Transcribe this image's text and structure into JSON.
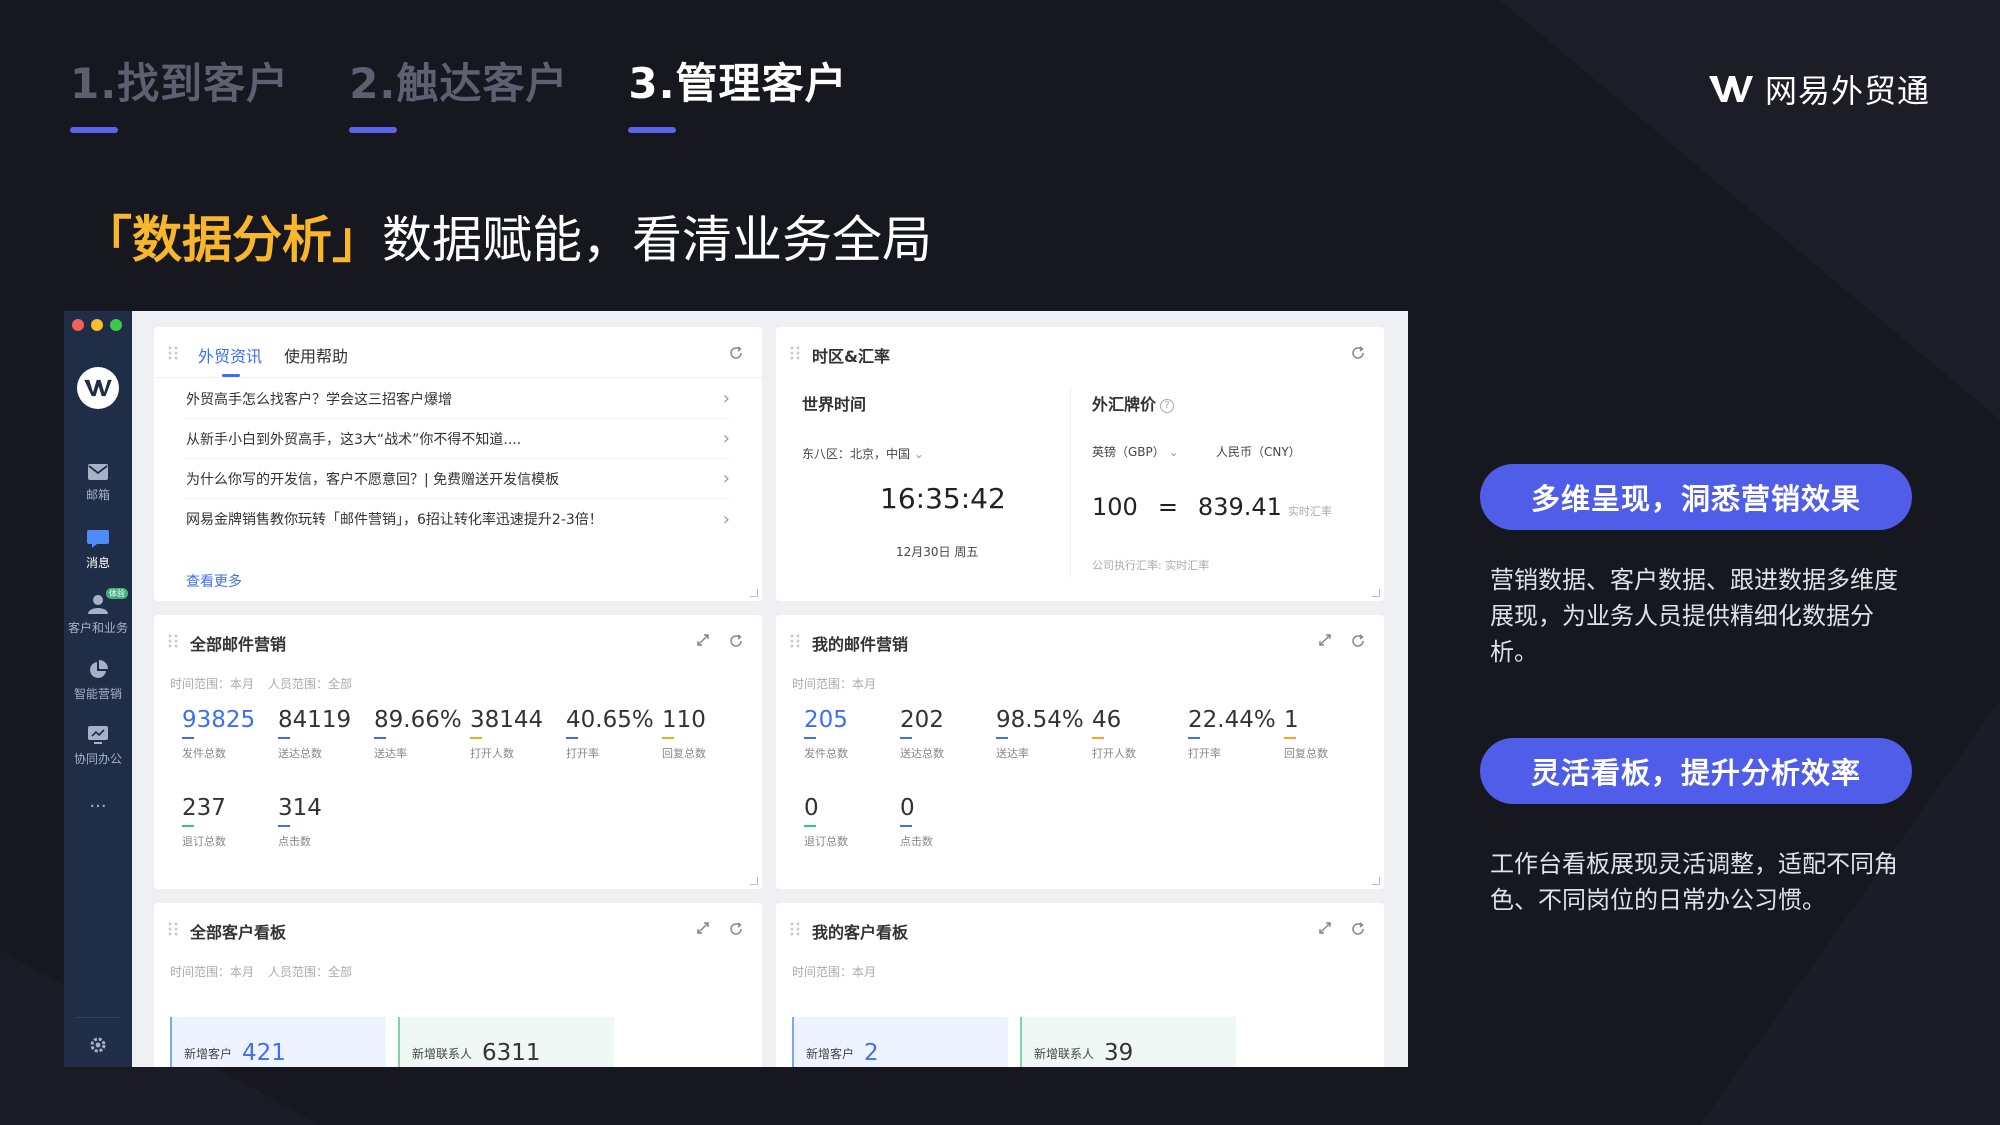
{
  "steps": [
    {
      "label": "1.找到客户",
      "active": false
    },
    {
      "label": "2.触达客户",
      "active": false
    },
    {
      "label": "3.管理客户",
      "active": true
    }
  ],
  "brand": {
    "name": "网易外贸通"
  },
  "headline": {
    "highlight": "「数据分析」",
    "rest": "数据赋能，看清业务全局"
  },
  "sidebar": {
    "items": [
      {
        "label": "邮箱",
        "icon": "mail-icon"
      },
      {
        "label": "消息",
        "icon": "message-icon"
      },
      {
        "label": "客户和业务",
        "icon": "customer-icon",
        "badge": "体验"
      },
      {
        "label": "智能营销",
        "icon": "pie-chart-icon"
      },
      {
        "label": "协同办公",
        "icon": "monitor-icon"
      }
    ],
    "more": "···"
  },
  "news_card": {
    "tabs": [
      "外贸资讯",
      "使用帮助"
    ],
    "items": [
      "外贸高手怎么找客户？学会这三招客户爆增",
      "从新手小白到外贸高手，这3大“战术”你不得不知道....",
      "为什么你写的开发信，客户不愿意回？| 免费赠送开发信模板",
      "网易金牌销售教你玩转「邮件营销」，6招让转化率迅速提升2-3倍！"
    ],
    "more": "查看更多"
  },
  "tz_card": {
    "title": "时区&汇率",
    "world_time": "世界时间",
    "zone": "东八区：北京，中国",
    "time": "16:35:42",
    "date": "12月30日 周五",
    "fx_title": "外汇牌价",
    "from_currency": "英镑（GBP）",
    "to_currency": "人民币（CNY）",
    "amount": "100",
    "equals": "=",
    "result": "839.41",
    "rate_tag": "实时汇率",
    "note": "公司执行汇率: 实时汇率"
  },
  "all_mail_card": {
    "title": "全部邮件营销",
    "range": "时间范围：本月",
    "people": "人员范围：全部",
    "stats": [
      {
        "value": "93825",
        "label": "发件总数",
        "color": "#3d6ff5"
      },
      {
        "value": "84119",
        "label": "送达总数",
        "color": "#3d6ff5"
      },
      {
        "value": "89.66%",
        "label": "送达率",
        "color": "#3d6ff5"
      },
      {
        "value": "38144",
        "label": "打开人数",
        "color": "#f5a623"
      },
      {
        "value": "40.65%",
        "label": "打开率",
        "color": "#3d6ff5"
      },
      {
        "value": "110",
        "label": "回复总数",
        "color": "#f5a623"
      },
      {
        "value": "237",
        "label": "退订总数",
        "color": "#36c28a"
      },
      {
        "value": "314",
        "label": "点击数",
        "color": "#3d6ff5"
      }
    ]
  },
  "my_mail_card": {
    "title": "我的邮件营销",
    "range": "时间范围：本月",
    "stats": [
      {
        "value": "205",
        "label": "发件总数",
        "color": "#3d6ff5"
      },
      {
        "value": "202",
        "label": "送达总数",
        "color": "#3d6ff5"
      },
      {
        "value": "98.54%",
        "label": "送达率",
        "color": "#3d6ff5"
      },
      {
        "value": "46",
        "label": "打开人数",
        "color": "#f5a623"
      },
      {
        "value": "22.44%",
        "label": "打开率",
        "color": "#3d6ff5"
      },
      {
        "value": "1",
        "label": "回复总数",
        "color": "#f5a623"
      },
      {
        "value": "0",
        "label": "退订总数",
        "color": "#36c28a"
      },
      {
        "value": "0",
        "label": "点击数",
        "color": "#3d6ff5"
      }
    ]
  },
  "all_customer_card": {
    "title": "全部客户看板",
    "range": "时间范围：本月",
    "people": "人员范围：全部",
    "new_customers_label": "新增客户",
    "new_customers": "421",
    "new_contacts_label": "新增联系人",
    "new_contacts": "6311"
  },
  "my_customer_card": {
    "title": "我的客户看板",
    "range": "时间范围：本月",
    "new_customers_label": "新增客户",
    "new_customers": "2",
    "new_contacts_label": "新增联系人",
    "new_contacts": "39"
  },
  "features": [
    {
      "title": "多维呈现，洞悉营销效果",
      "desc": "营销数据、客户数据、跟进数据多维度展现，为业务人员提供精细化数据分析。"
    },
    {
      "title": "灵活看板，提升分析效率",
      "desc": "工作台看板展现灵活调整，适配不同角色、不同岗位的日常办公习惯。"
    }
  ],
  "colors": {
    "accent": "#4f5de8",
    "highlight": "#f8b62c",
    "link": "#3d6ff5"
  }
}
